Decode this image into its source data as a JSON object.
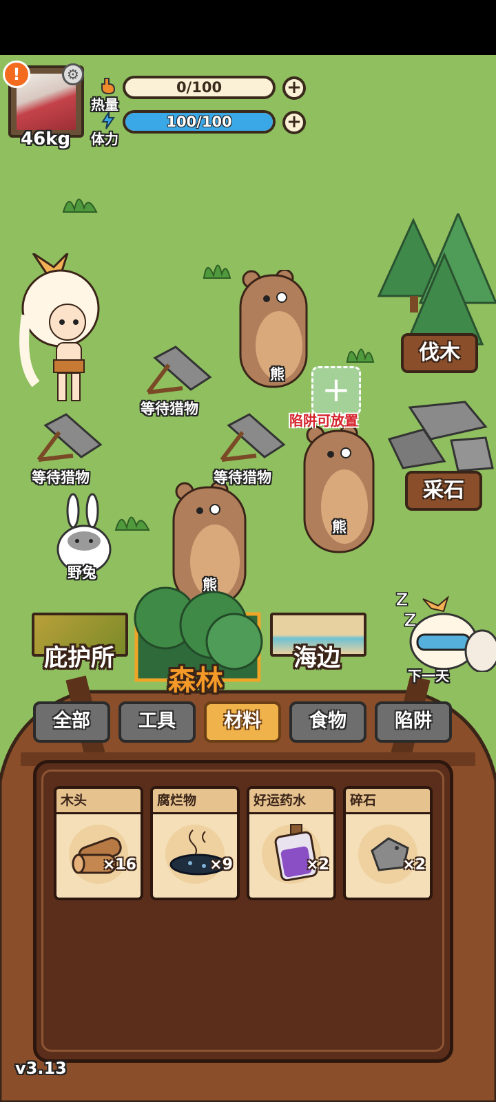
{
  "hud": {
    "weight": "46kg",
    "heat": {
      "label": "热量",
      "value": "0/100",
      "fraction": 0.0
    },
    "stamina": {
      "label": "体力",
      "value": "100/100",
      "fraction": 1.0
    },
    "alert_glyph": "!"
  },
  "world": {
    "bears": [
      {
        "label": "熊"
      },
      {
        "label": "熊"
      },
      {
        "label": "熊"
      }
    ],
    "traps": [
      {
        "label": "等待猎物"
      },
      {
        "label": "等待猎物"
      },
      {
        "label": "等待猎物"
      }
    ],
    "rabbit_label": "野兔",
    "trap_placeable": "陷阱可放置",
    "signs": {
      "chop": "伐木",
      "quarry": "采石"
    }
  },
  "maps": {
    "shelter": "庇护所",
    "forest": "森林",
    "beach": "海边",
    "next_day": "下一天",
    "zzz": "Z Z"
  },
  "categories": [
    "全部",
    "工具",
    "材料",
    "食物",
    "陷阱"
  ],
  "active_category": "材料",
  "inventory": [
    {
      "name": "木头",
      "count": "×16",
      "icon": "wood-logs-icon"
    },
    {
      "name": "腐烂物",
      "count": "×9",
      "icon": "rotten-matter-icon"
    },
    {
      "name": "好运药水",
      "count": "×2",
      "icon": "luck-potion-icon"
    },
    {
      "name": "碎石",
      "count": "×2",
      "icon": "gravel-icon"
    }
  ],
  "version": "v3.13",
  "colors": {
    "grass": "#8fbf5f",
    "stamina_bar": "#3aa7e6",
    "bag": "#8a4f2a",
    "active_tab": "#f0b24a"
  }
}
